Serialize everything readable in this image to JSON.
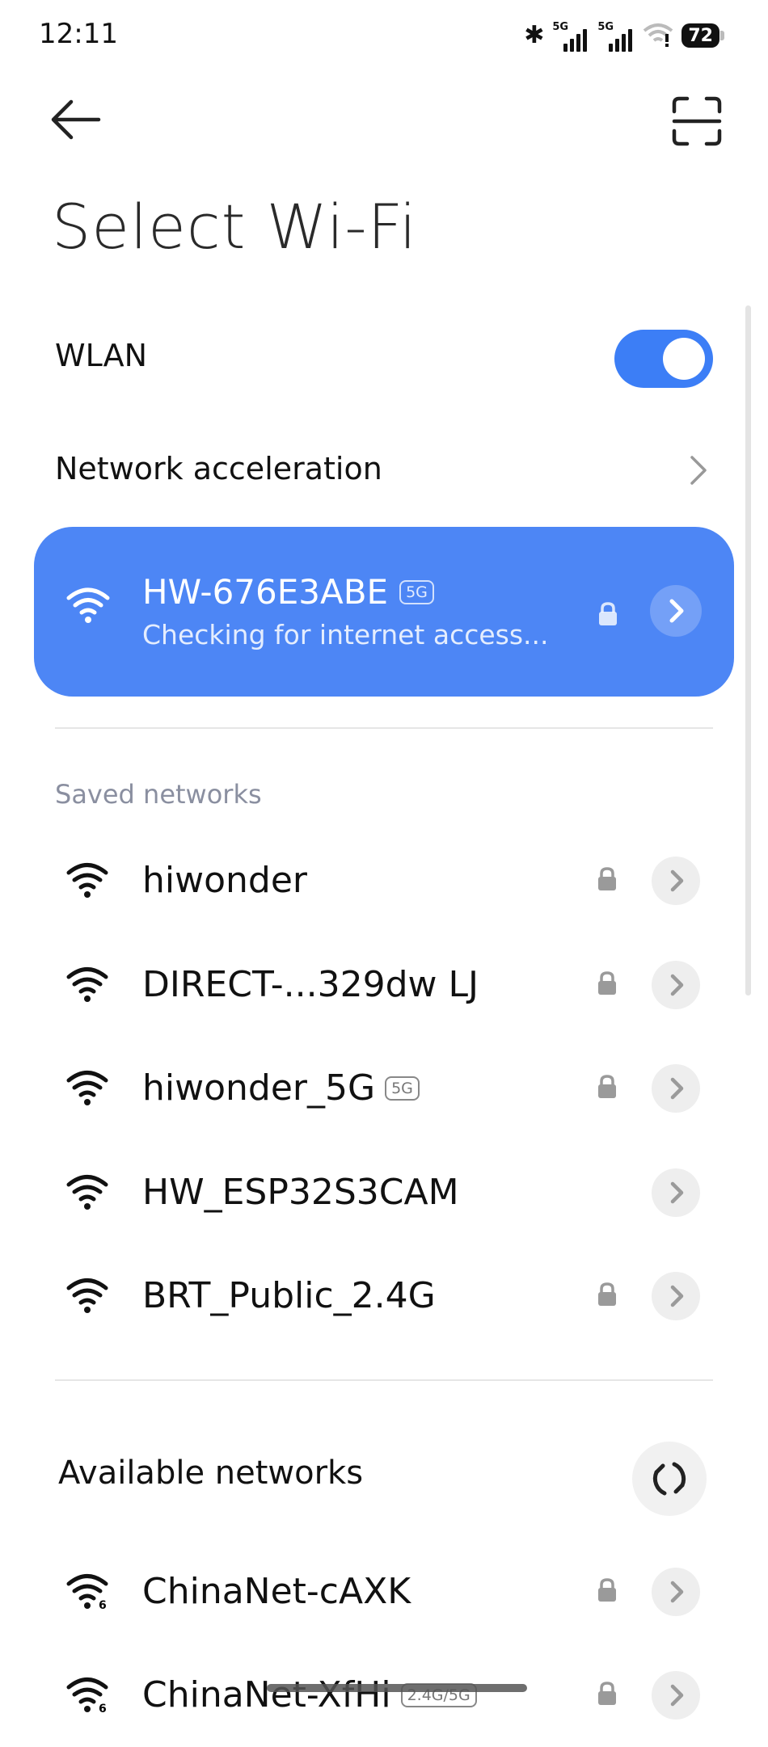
{
  "status_bar": {
    "time": "12:11",
    "battery": "72",
    "sim1": "5G",
    "sim2": "5G"
  },
  "header": {
    "title": "Select Wi-Fi"
  },
  "wlan": {
    "label": "WLAN",
    "enabled": true
  },
  "acceleration": {
    "label": "Network acceleration"
  },
  "connected": {
    "ssid": "HW-676E3ABE",
    "band": "5G",
    "status": "Checking for internet access..."
  },
  "saved": {
    "label": "Saved networks",
    "networks": [
      {
        "ssid": "hiwonder",
        "band": "",
        "locked": true
      },
      {
        "ssid": "DIRECT-...329dw LJ",
        "band": "",
        "locked": true
      },
      {
        "ssid": "hiwonder_5G",
        "band": "5G",
        "locked": true
      },
      {
        "ssid": "HW_ESP32S3CAM",
        "band": "",
        "locked": false
      },
      {
        "ssid": "BRT_Public_2.4G",
        "band": "",
        "locked": true
      }
    ]
  },
  "available": {
    "label": "Available networks",
    "networks": [
      {
        "ssid": "ChinaNet-cAXK",
        "band": "",
        "wifi_std": "6",
        "locked": true
      },
      {
        "ssid": "ChinaNet-XfHi",
        "band": "2.4G/5G",
        "wifi_std": "6",
        "locked": true
      }
    ]
  },
  "icons": {
    "back": "back-arrow-icon",
    "scan": "scan-qr-icon",
    "wifi": "wifi-icon",
    "lock": "lock-icon",
    "chevron": "chevron-right-icon",
    "refresh": "refresh-icon",
    "bluetooth": "bluetooth-icon",
    "battery": "battery-icon"
  },
  "colors": {
    "accent": "#3c7ef6",
    "card": "#4d86f5",
    "section_label": "#8a8fa0"
  }
}
